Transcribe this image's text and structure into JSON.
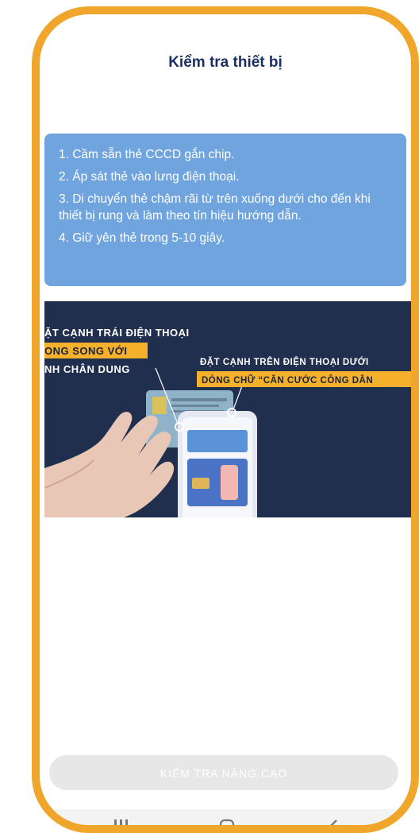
{
  "header": {
    "title": "Kiểm tra thiết bị"
  },
  "instructions": {
    "steps": [
      "1. Cầm sẵn thẻ CCCD gắn chip.",
      "2. Áp sát thẻ vào lưng điện thoại.",
      "3. Di chuyển thẻ chậm rãi từ trên xuống dưới cho đến khi thiết bị rung và làm theo tín hiệu hướng dẫn.",
      "4. Giữ yên thẻ trong 5-10 giây."
    ]
  },
  "video": {
    "left_line1": "ẶT CẠNH TRÁI ĐIỆN THOẠI",
    "left_line2": "ONG SONG VỚI",
    "left_line3": "NH CHÂN DUNG",
    "right_line1": "ĐẶT CẠNH TRÊN ĐIỆN THOẠI DƯỚI",
    "right_line2": "DÒNG CHỮ “CĂN CƯỚC CÔNG DÂN"
  },
  "footer": {
    "button_label": "KIỂM TRA NÂNG CAO"
  },
  "colors": {
    "frame": "#F0A52B",
    "title": "#1a2f63",
    "instruction_bg": "#6FA4DF",
    "highlight": "#F5B12C",
    "button_bg": "#e7e7e7"
  },
  "icons": {
    "nav_recent": "recent-apps-icon",
    "nav_home": "home-icon",
    "nav_back": "back-icon"
  }
}
